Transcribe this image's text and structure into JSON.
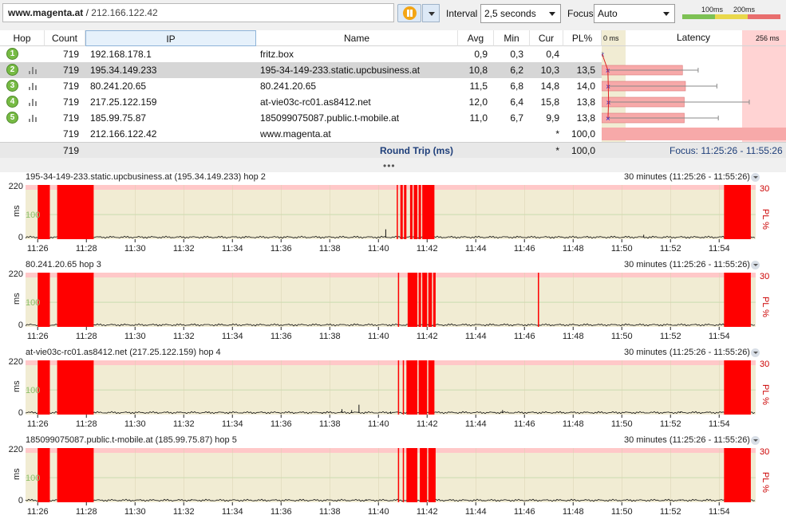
{
  "toolbar": {
    "target_host": "www.magenta.at",
    "target_sep": " / ",
    "target_ip": "212.166.122.42",
    "interval_label": "Interval",
    "interval_value": "2,5 seconds",
    "focus_label": "Focus",
    "focus_value": "Auto",
    "legend_100": "100ms",
    "legend_200": "200ms",
    "legend_colors": [
      "#7dc154",
      "#e9d84c",
      "#e86e6e"
    ]
  },
  "table": {
    "columns": [
      "Hop",
      "Count",
      "IP",
      "Name",
      "Avg",
      "Min",
      "Cur",
      "PL%"
    ],
    "latency_header": "Latency",
    "latency_min": "0 ms",
    "latency_max": "256 ms",
    "rows": [
      {
        "hop": "1",
        "count": "719",
        "ip": "192.168.178.1",
        "name": "fritz.box",
        "avg": "0,9",
        "min": "0,3",
        "cur": "0,4",
        "pl": "",
        "avg_ms": 0.9,
        "min_ms": 0.3,
        "max_ms": 1,
        "selected": false,
        "icon": false
      },
      {
        "hop": "2",
        "count": "719",
        "ip": "195.34.149.233",
        "name": "195-34-149-233.static.upcbusiness.at",
        "avg": "10,8",
        "min": "6,2",
        "cur": "10,3",
        "pl": "13,5",
        "avg_ms": 10.8,
        "min_ms": 6.2,
        "max_ms": 134,
        "selected": true,
        "icon": true
      },
      {
        "hop": "3",
        "count": "719",
        "ip": "80.241.20.65",
        "name": "80.241.20.65",
        "avg": "11,5",
        "min": "6,8",
        "cur": "14,8",
        "pl": "14,0",
        "avg_ms": 11.5,
        "min_ms": 6.8,
        "max_ms": 160,
        "selected": false,
        "icon": true
      },
      {
        "hop": "4",
        "count": "719",
        "ip": "217.25.122.159",
        "name": "at-vie03c-rc01.as8412.net",
        "avg": "12,0",
        "min": "6,4",
        "cur": "15,8",
        "pl": "13,8",
        "avg_ms": 12.0,
        "min_ms": 6.4,
        "max_ms": 205,
        "selected": false,
        "icon": true
      },
      {
        "hop": "5",
        "count": "719",
        "ip": "185.99.75.87",
        "name": "185099075087.public.t-mobile.at",
        "avg": "11,0",
        "min": "6,7",
        "cur": "9,9",
        "pl": "13,8",
        "avg_ms": 11.0,
        "min_ms": 6.7,
        "max_ms": 162,
        "selected": false,
        "icon": true
      },
      {
        "hop": "",
        "count": "719",
        "ip": "212.166.122.42",
        "name": "www.magenta.at",
        "avg": "",
        "min": "",
        "cur": "*",
        "pl": "100,0",
        "avg_ms": null,
        "min_ms": null,
        "max_ms": null,
        "selected": false,
        "icon": false
      }
    ],
    "summary": {
      "count": "719",
      "label": "Round Trip (ms)",
      "cur": "*",
      "pl": "100,0",
      "focus": "Focus: 11:25:26 - 11:55:26"
    }
  },
  "graphs": [
    {
      "title": "195-34-149-233.static.upcbusiness.at (195.34.149.233) hop 2",
      "range": "30 minutes (11:25:26 - 11:55:26)",
      "loss": [
        [
          26.0,
          26.5
        ],
        [
          26.8,
          28.3
        ],
        [
          40.75,
          40.8
        ],
        [
          40.9,
          41.0
        ],
        [
          41.05,
          41.15
        ],
        [
          41.3,
          41.4
        ],
        [
          41.45,
          41.6
        ],
        [
          41.65,
          41.75
        ],
        [
          41.8,
          42.3
        ],
        [
          54.2,
          55.3
        ]
      ],
      "spikes": [
        [
          40.3,
          40
        ],
        [
          50.9,
          18
        ],
        [
          42.7,
          8
        ]
      ]
    },
    {
      "title": "80.241.20.65 hop 3",
      "range": "30 minutes (11:25:26 - 11:55:26)",
      "loss": [
        [
          26.0,
          26.5
        ],
        [
          26.8,
          28.3
        ],
        [
          40.8,
          40.85
        ],
        [
          41.2,
          41.6
        ],
        [
          41.65,
          41.75
        ],
        [
          41.8,
          42.0
        ],
        [
          42.05,
          42.2
        ],
        [
          42.25,
          42.35
        ],
        [
          46.55,
          46.6
        ],
        [
          54.2,
          55.3
        ]
      ],
      "spikes": [
        [
          41.35,
          110
        ],
        [
          52.0,
          8
        ]
      ]
    },
    {
      "title": "at-vie03c-rc01.as8412.net (217.25.122.159) hop 4",
      "range": "30 minutes (11:25:26 - 11:55:26)",
      "loss": [
        [
          26.0,
          26.5
        ],
        [
          26.8,
          28.3
        ],
        [
          40.8,
          40.85
        ],
        [
          41.0,
          41.05
        ],
        [
          41.15,
          41.6
        ],
        [
          41.65,
          42.0
        ],
        [
          42.05,
          42.3
        ],
        [
          54.2,
          55.3
        ]
      ],
      "spikes": [
        [
          33.0,
          10
        ],
        [
          37.7,
          8
        ],
        [
          38.5,
          22
        ],
        [
          38.9,
          18
        ],
        [
          39.2,
          40
        ],
        [
          40.5,
          12
        ],
        [
          45.1,
          18
        ],
        [
          52.4,
          12
        ]
      ]
    },
    {
      "title": "185099075087.public.t-mobile.at (185.99.75.87) hop 5",
      "range": "30 minutes (11:25:26 - 11:55:26)",
      "loss": [
        [
          26.0,
          26.5
        ],
        [
          26.8,
          28.3
        ],
        [
          40.8,
          40.85
        ],
        [
          41.0,
          41.05
        ],
        [
          41.15,
          41.6
        ],
        [
          41.7,
          42.0
        ],
        [
          42.05,
          42.35
        ],
        [
          54.2,
          55.3
        ]
      ],
      "spikes": [
        [
          32.3,
          8
        ],
        [
          39.5,
          12
        ],
        [
          47.3,
          8
        ],
        [
          52.4,
          10
        ]
      ]
    }
  ],
  "axis": {
    "ms_label": "ms",
    "pl_label": "PL %",
    "y_ticks": [
      "220",
      "100",
      "0"
    ],
    "pl_max": "30",
    "x_ticks": [
      "11:26",
      "11:28",
      "11:30",
      "11:32",
      "11:34",
      "11:36",
      "11:38",
      "11:40",
      "11:42",
      "11:44",
      "11:46",
      "11:48",
      "11:50",
      "11:52",
      "11:54"
    ]
  },
  "colors": {
    "plot_bg": "#f1ecd3",
    "loss": "#ff0000",
    "top_band": "#ffc8c8",
    "grid": "#c9dcb0",
    "latency_bar": "#f7a9a9"
  }
}
